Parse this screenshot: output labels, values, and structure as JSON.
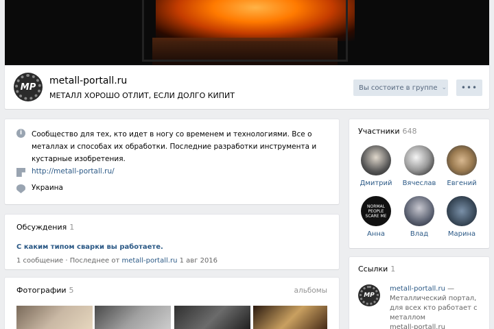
{
  "group": {
    "name": "metall-portall.ru",
    "status": "МЕТАЛЛ ХОРОШО ОТЛИТ, ЕСЛИ ДОЛГО КИПИТ",
    "logo_text": "МР",
    "member_button": "Вы состоите в группе",
    "more_button": "•••"
  },
  "info": {
    "description": "Сообщество для тех, кто идет в ногу со временем и технологиями. Все о металлах и способах их обработки. Последние разработки инструмента и кустарные изобретения.",
    "site": "http://metall-portall.ru/",
    "country": "Украина"
  },
  "discussions": {
    "title": "Обсуждения",
    "count": "1",
    "topic": "С каким типом сварки вы работаете.",
    "meta_prefix": "1 сообщение · Последнее от ",
    "meta_author": "metall-portall.ru",
    "meta_date": " 1 авг 2016"
  },
  "photos": {
    "title": "Фотографии",
    "count": "5",
    "albums_link": "альбомы"
  },
  "members": {
    "title": "Участники",
    "count": "648",
    "list": [
      {
        "name": "Дмитрий"
      },
      {
        "name": "Вячеслав"
      },
      {
        "name": "Евгений"
      },
      {
        "name": "Анна",
        "avatar_text": "NORMAL PEOPLE SCARE ME"
      },
      {
        "name": "Влад"
      },
      {
        "name": "Марина"
      }
    ]
  },
  "links": {
    "title": "Ссылки",
    "count": "1",
    "item_name": "metall-portall.ru",
    "item_desc": " — Металлический портал, для всех кто работает с металлом",
    "item_url": "metall-portall.ru"
  }
}
